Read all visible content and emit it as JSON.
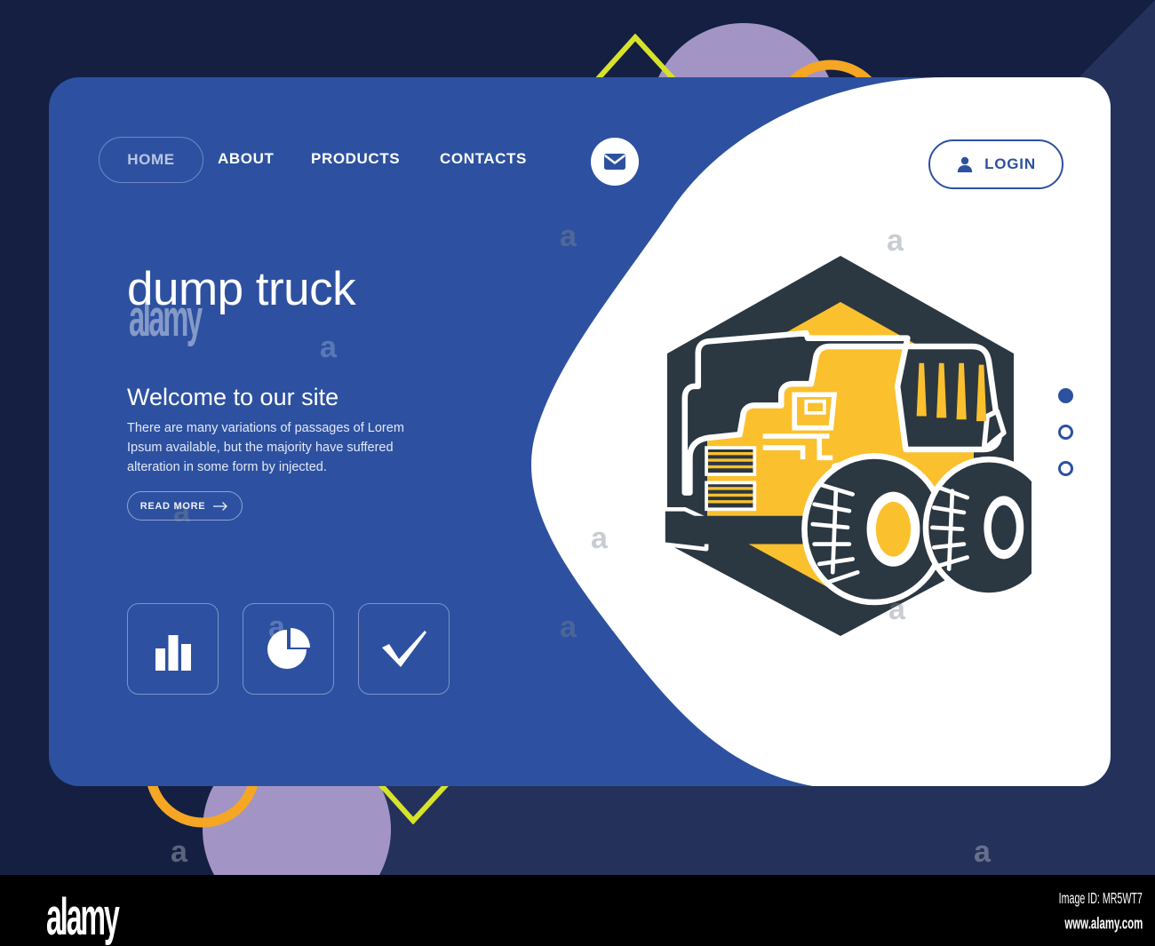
{
  "page": {
    "background_color": "#141f42",
    "panel_color": "#2d51a0",
    "accent_yellow": "#fbc02d",
    "accent_orange": "#f5a623",
    "accent_lime": "#d7e22a",
    "accent_purple": "#a394c6",
    "illustration_dark": "#2b3741"
  },
  "nav": {
    "home_label": "HOME",
    "links": [
      {
        "label": "ABOUT"
      },
      {
        "label": "PRODUCTS"
      },
      {
        "label": "CONTACTS"
      }
    ],
    "mail_icon": "envelope-icon",
    "login_label": "LOGIN",
    "login_icon": "user-icon"
  },
  "hero": {
    "title": "dump truck",
    "subtitle": "Welcome to our site",
    "paragraph": "There are many variations of passages of Lorem Ipsum available, but the majority have suffered alteration in some form by injected.",
    "cta_label": "READ MORE",
    "cta_icon": "arrow-right-icon"
  },
  "features": [
    {
      "icon": "bar-chart-icon"
    },
    {
      "icon": "pie-chart-icon"
    },
    {
      "icon": "check-icon"
    }
  ],
  "carousel": {
    "dots": [
      {
        "active": true
      },
      {
        "active": false
      },
      {
        "active": false
      }
    ]
  },
  "illustration": {
    "name": "dump-truck-hexagon-badge",
    "hexagon_color": "#2b3741",
    "inner_color": "#fbc02d"
  },
  "watermarks": {
    "word": "alamy",
    "letter": "a"
  },
  "footer": {
    "logo": "alamy",
    "image_id": "Image ID: MR5WT7",
    "url": "www.alamy.com"
  }
}
